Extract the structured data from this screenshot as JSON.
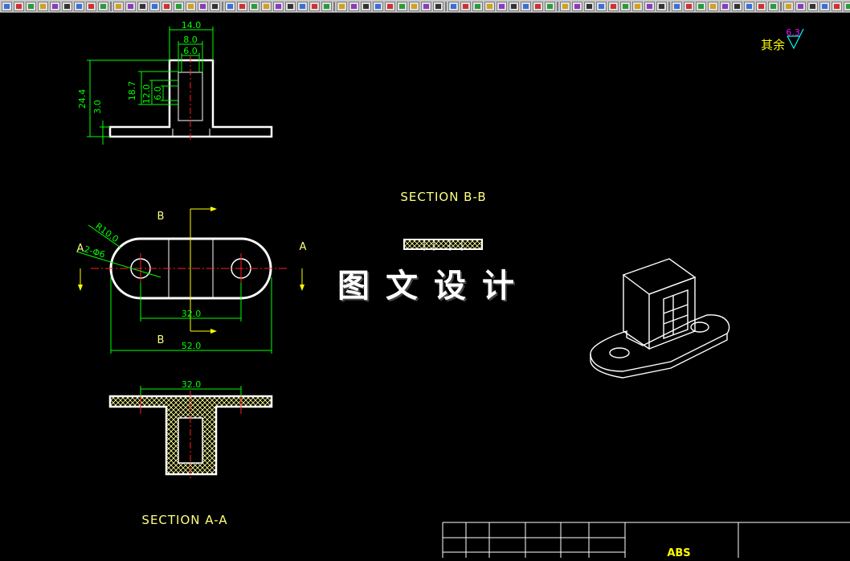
{
  "toolbar": {
    "button_count": 70,
    "icon_names": [
      "layer-icon",
      "draw-icon",
      "modify-icon",
      "dimension-icon",
      "zoom-icon",
      "pan-icon",
      "properties-icon",
      "text-icon"
    ]
  },
  "drawing": {
    "section_bb_label": "SECTION B-B",
    "section_aa_label": "SECTION A-A",
    "watermark": "图文设计",
    "roughness_prefix": "其余",
    "roughness_value": "6.3",
    "cut_label_a_left": "A",
    "cut_label_a_right": "A",
    "cut_label_b_top": "B",
    "cut_label_b_bottom": "B",
    "material": "ABS",
    "colors": {
      "background": "#000000",
      "outline": "#ffffff",
      "dimension": "#00ff00",
      "centerline": "#ff0000",
      "section_text": "#ffff80",
      "hatch": "#ffff99",
      "roughness_value": "#ff00ff"
    },
    "front_view_dims": {
      "d1": "14.0",
      "d2": "8.0",
      "d3": "6.0",
      "d4": "24.4",
      "d5": "18.7",
      "d6": "12.0",
      "d7": "6.0",
      "d8": "3.0"
    },
    "top_view_dims": {
      "radius": "R10.0",
      "holes": "2-Φ6",
      "center_dist": "32.0",
      "overall": "52.0"
    },
    "section_aa_dims": {
      "span": "32.0"
    }
  }
}
